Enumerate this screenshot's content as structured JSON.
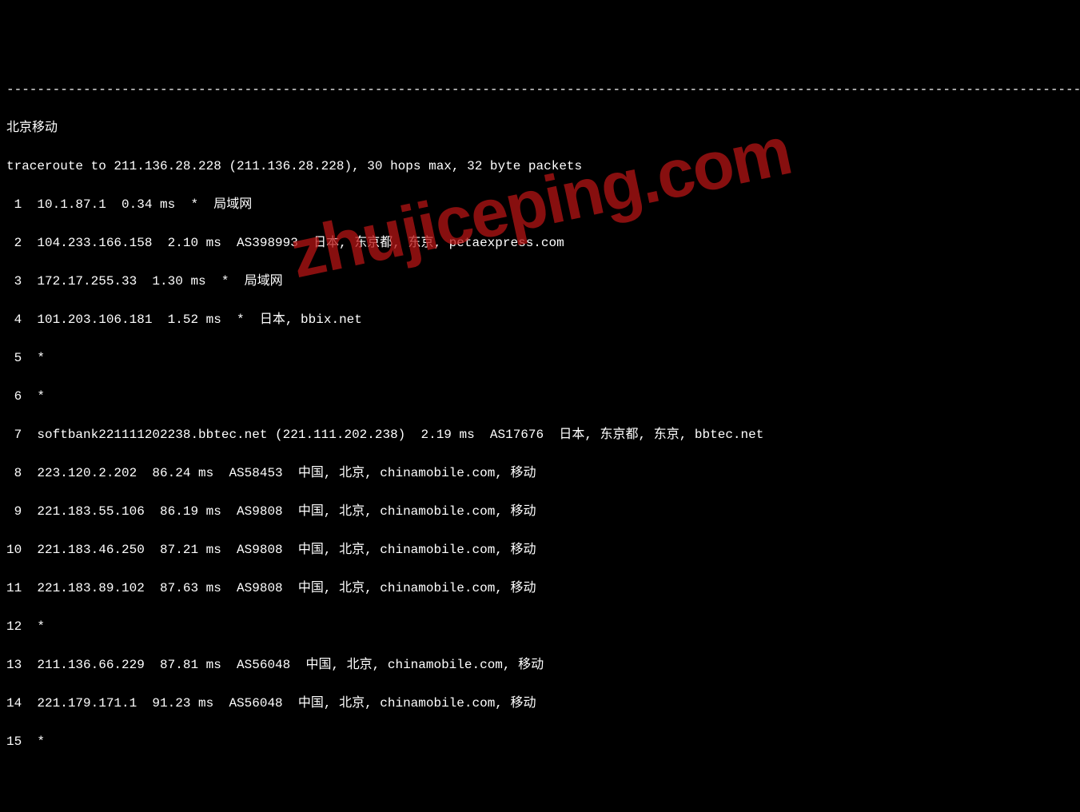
{
  "separator": "----------------------------------------------------------------------------------------------------------------------------------------------------",
  "title": "北京移动",
  "header": "traceroute to 211.136.28.228 (211.136.28.228), 30 hops max, 32 byte packets",
  "hops": [
    {
      "num": " 1",
      "line": "10.1.87.1  0.34 ms  *  局域网"
    },
    {
      "num": " 2",
      "line": "104.233.166.158  2.10 ms  AS398993  日本, 东京都, 东京, petaexpress.com"
    },
    {
      "num": " 3",
      "line": "172.17.255.33  1.30 ms  *  局域网"
    },
    {
      "num": " 4",
      "line": "101.203.106.181  1.52 ms  *  日本, bbix.net"
    },
    {
      "num": " 5",
      "line": "*"
    },
    {
      "num": " 6",
      "line": "*"
    },
    {
      "num": " 7",
      "line": "softbank221111202238.bbtec.net (221.111.202.238)  2.19 ms  AS17676  日本, 东京都, 东京, bbtec.net"
    },
    {
      "num": " 8",
      "line": "223.120.2.202  86.24 ms  AS58453  中国, 北京, chinamobile.com, 移动"
    },
    {
      "num": " 9",
      "line": "221.183.55.106  86.19 ms  AS9808  中国, 北京, chinamobile.com, 移动"
    },
    {
      "num": "10",
      "line": "221.183.46.250  87.21 ms  AS9808  中国, 北京, chinamobile.com, 移动"
    },
    {
      "num": "11",
      "line": "221.183.89.102  87.63 ms  AS9808  中国, 北京, chinamobile.com, 移动"
    },
    {
      "num": "12",
      "line": "*"
    },
    {
      "num": "13",
      "line": "211.136.66.229  87.81 ms  AS56048  中国, 北京, chinamobile.com, 移动"
    },
    {
      "num": "14",
      "line": "221.179.171.1  91.23 ms  AS56048  中国, 北京, chinamobile.com, 移动"
    },
    {
      "num": "15",
      "line": "*"
    }
  ],
  "watermark": "zhujiceping.com"
}
